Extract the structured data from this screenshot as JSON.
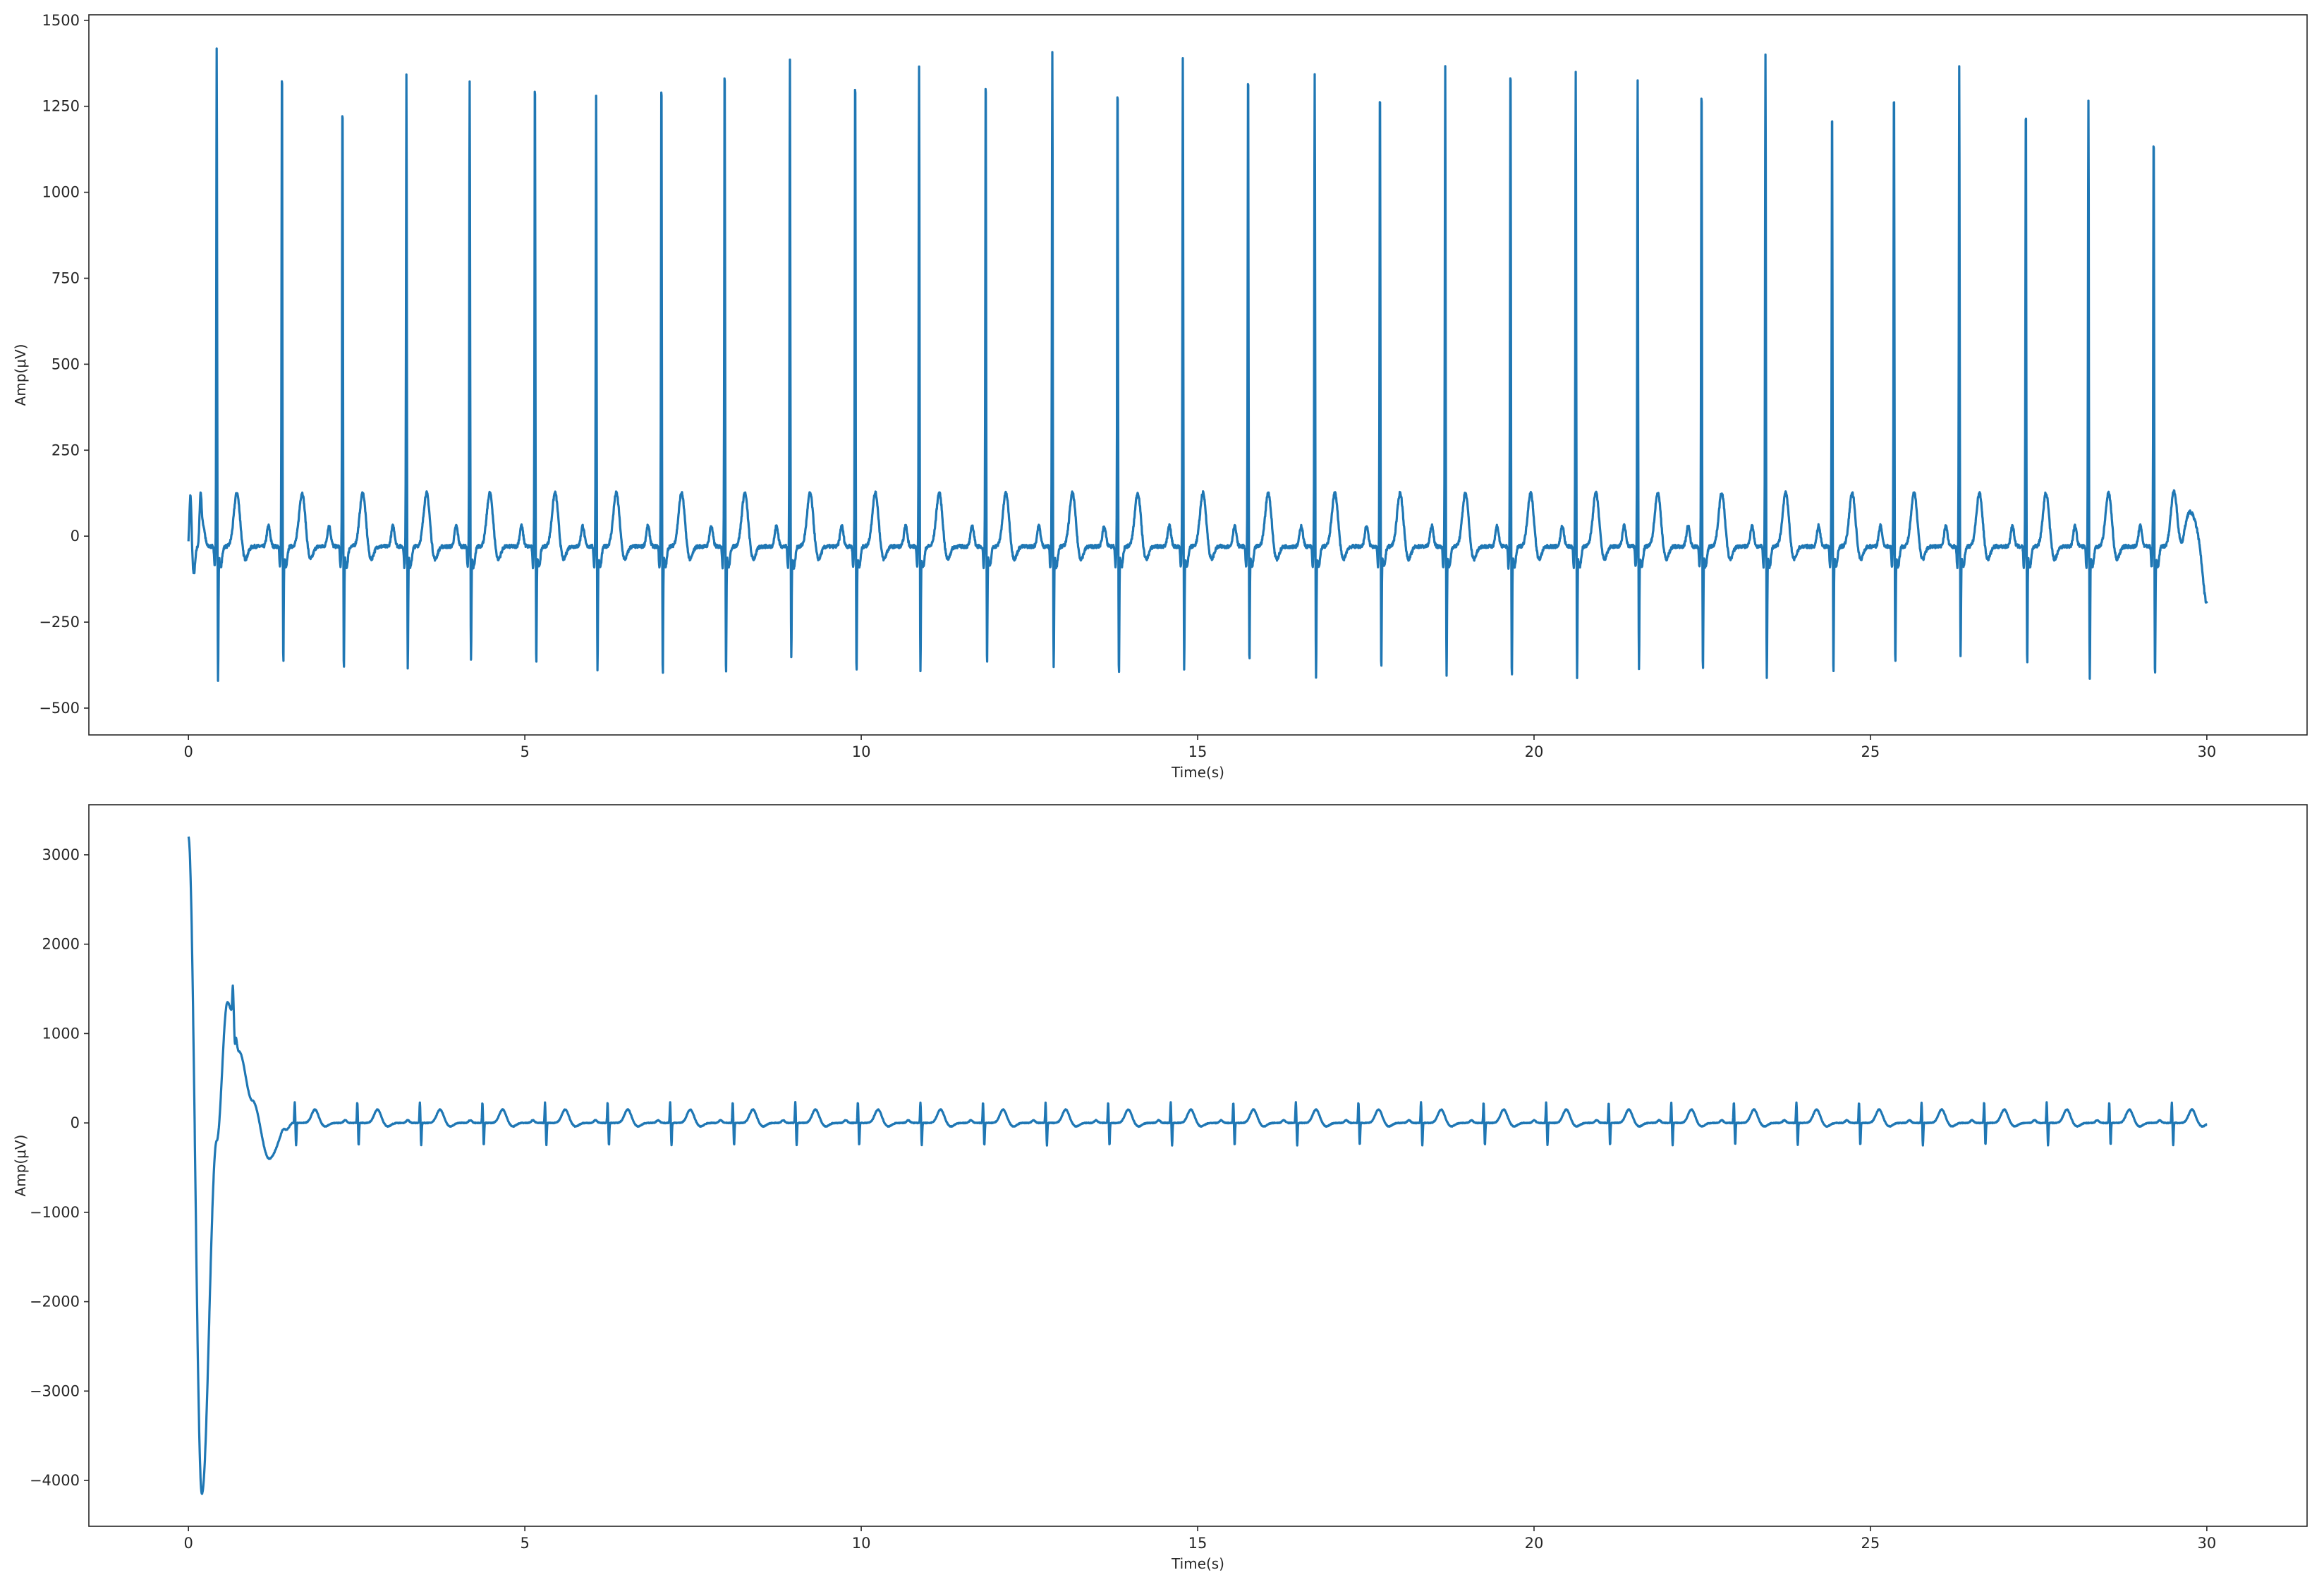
{
  "chart_data": [
    {
      "type": "line",
      "title": "",
      "xlabel": "Time(s)",
      "ylabel": "Amp(μV)",
      "xlim": [
        -1.48,
        31.49
      ],
      "ylim": [
        -578,
        1516
      ],
      "xticks": [
        0,
        5,
        10,
        15,
        20,
        25,
        30
      ],
      "yticks": [
        -500,
        -250,
        0,
        250,
        500,
        750,
        1000,
        1250,
        1500
      ],
      "xtick_labels": [
        "0",
        "5",
        "10",
        "15",
        "20",
        "25",
        "30"
      ],
      "ytick_labels": [
        "−500",
        "−250",
        "0",
        "250",
        "500",
        "750",
        "1000",
        "1250",
        "1500"
      ],
      "color": "#1f77b4",
      "duration_s": 30,
      "r_peak_times": [
        0.42,
        1.39,
        2.29,
        3.24,
        4.18,
        5.15,
        6.06,
        7.03,
        7.97,
        8.94,
        9.91,
        10.86,
        11.85,
        12.84,
        13.81,
        14.78,
        15.75,
        16.74,
        17.71,
        18.68,
        19.65,
        20.62,
        21.54,
        22.49,
        23.44,
        24.43,
        25.35,
        26.32,
        27.31,
        28.24,
        29.21
      ],
      "r_peak_values": [
        1425,
        1400,
        1290,
        1340,
        1320,
        1365,
        1280,
        1365,
        1410,
        1390,
        1370,
        1370,
        1375,
        1410,
        1350,
        1390,
        1395,
        1345,
        1340,
        1365,
        1410,
        1355,
        1330,
        1345,
        1400,
        1280,
        1340,
        1370,
        1285,
        1270,
        1205
      ],
      "s_trough_values": [
        -480,
        -430,
        -450,
        -440,
        -420,
        -430,
        -450,
        -465,
        -465,
        -410,
        -455,
        -450,
        -430,
        -440,
        -465,
        -440,
        -430,
        -470,
        -450,
        -465,
        -475,
        -465,
        -440,
        -450,
        -465,
        -460,
        -430,
        -410,
        -435,
        -470,
        -470
      ],
      "t_wave_amplitude": 130,
      "baseline": -30,
      "end_value": -200
    },
    {
      "type": "line",
      "title": "",
      "xlabel": "Time(s)",
      "ylabel": "Amp(μV)",
      "xlim": [
        -1.48,
        31.49
      ],
      "ylim": [
        -4513,
        3560
      ],
      "xticks": [
        0,
        5,
        10,
        15,
        20,
        25,
        30
      ],
      "yticks": [
        -4000,
        -3000,
        -2000,
        -1000,
        0,
        1000,
        2000,
        3000
      ],
      "xtick_labels": [
        "0",
        "5",
        "10",
        "15",
        "20",
        "25",
        "30"
      ],
      "ytick_labels": [
        "−4000",
        "−3000",
        "−2000",
        "−1000",
        "0",
        "1000",
        "2000",
        "3000"
      ],
      "color": "#1f77b4",
      "duration_s": 30,
      "initial_transient": [
        [
          0,
          3200
        ],
        [
          0.2,
          -4150
        ],
        [
          0.42,
          -200
        ],
        [
          0.58,
          1350
        ],
        [
          0.65,
          1250
        ],
        [
          0.75,
          800
        ],
        [
          0.95,
          250
        ],
        [
          1.2,
          -400
        ],
        [
          1.45,
          -80
        ],
        [
          1.55,
          0
        ]
      ],
      "r_peak_first_time": 1.58,
      "rr_interval_s": 0.93,
      "r_peak_amplitude": 230,
      "s_trough_amplitude": -250,
      "t_wave_amplitude": 150
    }
  ]
}
